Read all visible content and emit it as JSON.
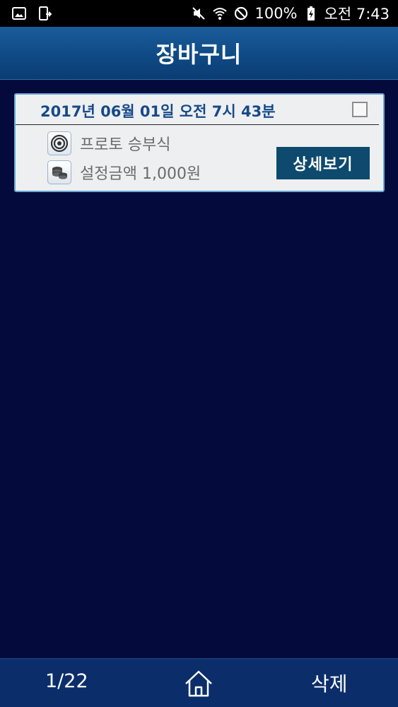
{
  "status_bar": {
    "left_icons": [
      "gallery-icon",
      "screen-mirror-icon"
    ],
    "right_icons": [
      "mute-icon",
      "wifi-icon",
      "blocked-icon",
      "battery-charging-icon"
    ],
    "battery": "100%",
    "clock": "오전 7:43"
  },
  "header": {
    "title": "장바구니"
  },
  "cart_items": [
    {
      "datetime": "2017년 06월  01일   오전 7시 43분",
      "game_type": "프로토 승부식",
      "amount": "설정금액 1,000원",
      "detail_label": "상세보기",
      "checked": false,
      "game_icon": "target-icon",
      "amount_icon": "coins-icon"
    }
  ],
  "bottom_bar": {
    "page_indicator": "1/22",
    "home_icon": "home-icon",
    "delete_label": "삭제"
  },
  "colors": {
    "background": "#050a3c",
    "header": "#0f4a85",
    "card_date": "#164a88",
    "detail_button": "#0e4a6e",
    "bottom_bar": "#0b2e6a"
  }
}
